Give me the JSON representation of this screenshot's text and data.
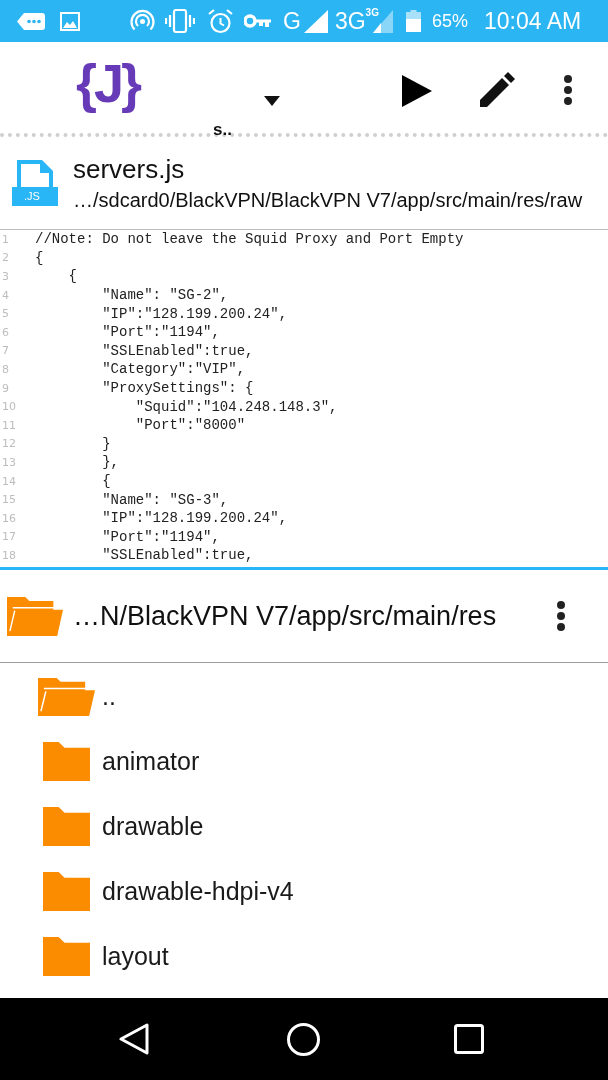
{
  "status_bar": {
    "network_1": "G",
    "network_2": "3G",
    "network_2_badge": "3G",
    "battery": "65%",
    "time": "10:04 AM"
  },
  "toolbar": {
    "logo": "{J}",
    "file_selector": "s.."
  },
  "file_header": {
    "name": "servers.js",
    "icon_label": ".JS",
    "path": "…/sdcard0/BlackVPN/BlackVPN V7/app/src/main/res/raw"
  },
  "editor": {
    "lines": [
      {
        "number": "1",
        "text": "//Note: Do not leave the Squid Proxy and Port Empty"
      },
      {
        "number": "2",
        "text": "{"
      },
      {
        "number": "3",
        "text": "    {"
      },
      {
        "number": "4",
        "text": "        \"Name\": \"SG-2\","
      },
      {
        "number": "5",
        "text": "        \"IP\":\"128.199.200.24\","
      },
      {
        "number": "6",
        "text": "        \"Port\":\"1194\","
      },
      {
        "number": "7",
        "text": "        \"SSLEnabled\":true,"
      },
      {
        "number": "8",
        "text": "        \"Category\":\"VIP\","
      },
      {
        "number": "9",
        "text": "        \"ProxySettings\": {"
      },
      {
        "number": "10",
        "text": "            \"Squid\":\"104.248.148.3\","
      },
      {
        "number": "11",
        "text": "            \"Port\":\"8000\""
      },
      {
        "number": "12",
        "text": "        }"
      },
      {
        "number": "13",
        "text": "        },"
      },
      {
        "number": "14",
        "text": "        {"
      },
      {
        "number": "15",
        "text": "        \"Name\": \"SG-3\","
      },
      {
        "number": "16",
        "text": "        \"IP\":\"128.199.200.24\","
      },
      {
        "number": "17",
        "text": "        \"Port\":\"1194\","
      },
      {
        "number": "18",
        "text": "        \"SSLEnabled\":true,"
      }
    ]
  },
  "browser": {
    "path": "…N/BlackVPN V7/app/src/main/res",
    "items": [
      {
        "name": "..",
        "kind": "parent"
      },
      {
        "name": "animator",
        "kind": "folder"
      },
      {
        "name": "drawable",
        "kind": "folder"
      },
      {
        "name": "drawable-hdpi-v4",
        "kind": "folder"
      },
      {
        "name": "layout",
        "kind": "folder"
      }
    ]
  }
}
